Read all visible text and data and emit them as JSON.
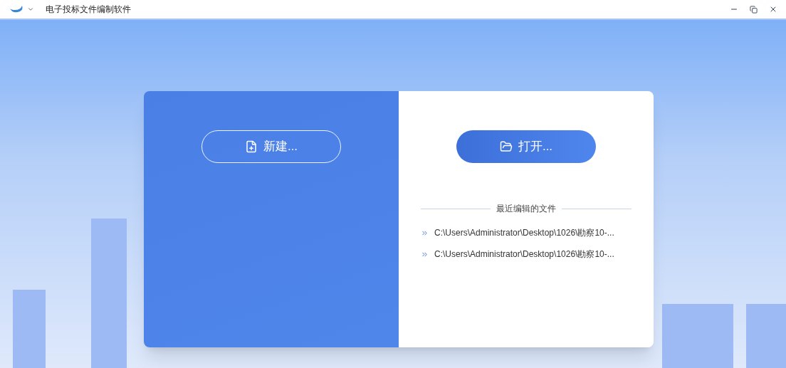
{
  "window": {
    "title": "电子投标文件编制软件"
  },
  "new_button": {
    "label": "新建..."
  },
  "open_button": {
    "label": "打开..."
  },
  "recent": {
    "heading": "最近编辑的文件",
    "files": [
      {
        "path": "C:\\Users\\Administrator\\Desktop\\1026\\勘察10-..."
      },
      {
        "path": "C:\\Users\\Administrator\\Desktop\\1026\\勘察10-..."
      }
    ]
  }
}
